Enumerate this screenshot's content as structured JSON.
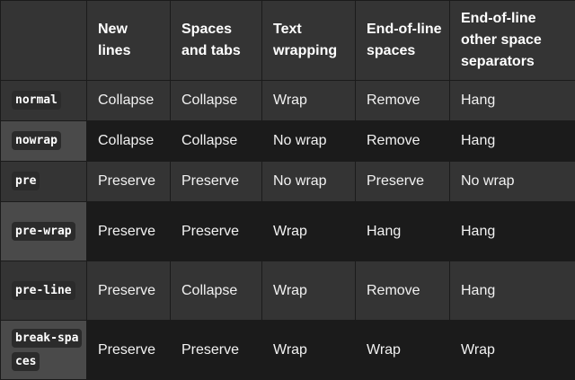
{
  "table": {
    "headers": [
      "",
      "New lines",
      "Spaces and tabs",
      "Text wrapping",
      "End-of-line spaces",
      "End-of-line other space separators"
    ],
    "rows": [
      {
        "keyword": "normal",
        "cells": [
          "Collapse",
          "Collapse",
          "Wrap",
          "Remove",
          "Hang"
        ]
      },
      {
        "keyword": "nowrap",
        "cells": [
          "Collapse",
          "Collapse",
          "No wrap",
          "Remove",
          "Hang"
        ]
      },
      {
        "keyword": "pre",
        "cells": [
          "Preserve",
          "Preserve",
          "No wrap",
          "Preserve",
          "No wrap"
        ]
      },
      {
        "keyword": "pre-wrap",
        "cells": [
          "Preserve",
          "Preserve",
          "Wrap",
          "Hang",
          "Hang"
        ]
      },
      {
        "keyword": "pre-line",
        "cells": [
          "Preserve",
          "Collapse",
          "Wrap",
          "Remove",
          "Hang"
        ]
      },
      {
        "keyword": "break-spaces",
        "cells": [
          "Preserve",
          "Preserve",
          "Wrap",
          "Wrap",
          "Wrap"
        ]
      }
    ]
  },
  "colors": {
    "header_bg": "#343434",
    "row_light": "#343434",
    "row_dark": "#1b1b1b",
    "code_bg": "#2b2b2b",
    "text": "#ffffff"
  }
}
